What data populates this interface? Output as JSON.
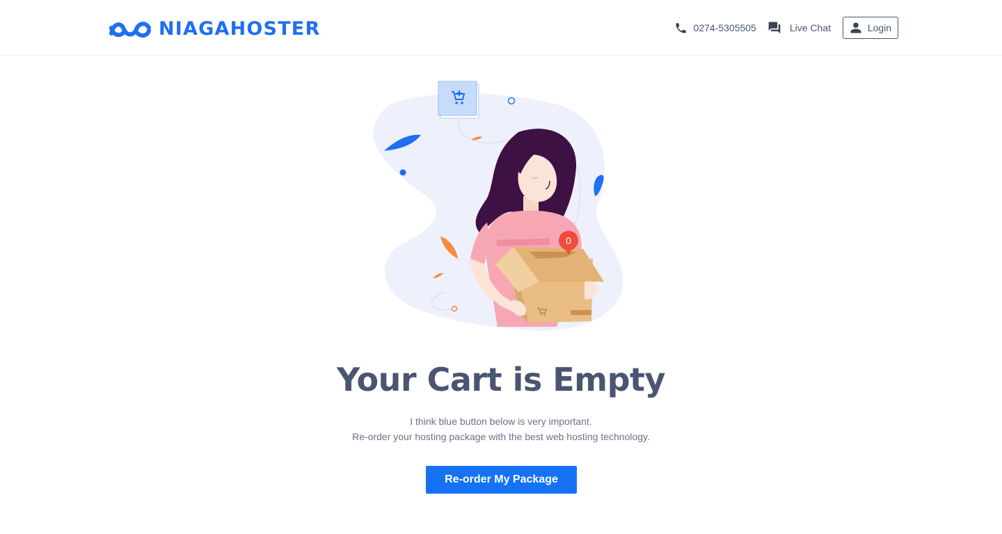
{
  "header": {
    "brand": "NIAGAHOSTER",
    "phone": "0274-5305505",
    "live_chat": "Live Chat",
    "login": "Login",
    "icons": [
      "logo-mark",
      "phone-icon",
      "chat-icon",
      "user-icon"
    ]
  },
  "illustration": {
    "badge_count": "0",
    "icons": [
      "add-to-cart-icon",
      "cart-icon"
    ]
  },
  "empty_state": {
    "title": "Your Cart is Empty",
    "line1": "I think blue button below is very important.",
    "line2": "Re-order your hosting package with the best web hosting technology.",
    "button": "Re-order My Package"
  },
  "colors": {
    "brand_blue": "#1e6ff2",
    "button_blue": "#1572f5",
    "text_dark": "#4a5572",
    "text_muted": "#68718a",
    "badge_red": "#f04b3c",
    "box": "#e9bd84",
    "shirt": "#f7a7b4",
    "hair": "#3d1142",
    "accent_orange": "#f58a3b"
  }
}
